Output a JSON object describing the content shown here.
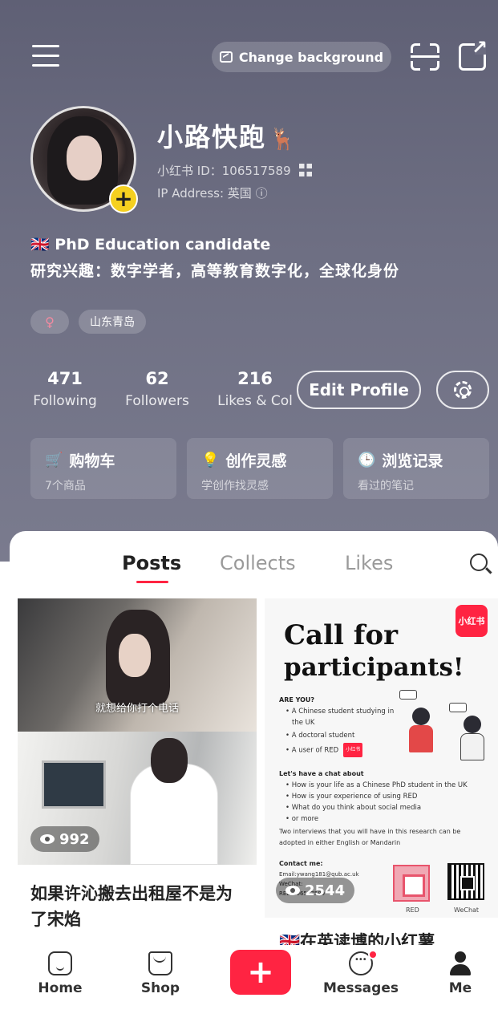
{
  "header": {
    "change_background": "Change background",
    "nickname": "小路快跑",
    "nickname_emoji": "🦌",
    "red_id": "小红书 ID：106517589",
    "ip_address": "IP Address: 英国 ⓘ",
    "bio_line1": "🇬🇧 PhD Education candidate",
    "bio_line2": "研究兴趣：数字学者，高等教育数字化，全球化身份",
    "gender_symbol": "♀",
    "location_tag": "山东青岛",
    "stats": {
      "following_num": "471",
      "following_label": "Following",
      "followers_num": "62",
      "followers_label": "Followers",
      "likes_num": "216",
      "likes_label": "Likes & Col"
    },
    "edit_profile": "Edit Profile",
    "cards": [
      {
        "icon": "🛒",
        "title": "购物车",
        "subtitle": "7个商品"
      },
      {
        "icon": "💡",
        "title": "创作灵感",
        "subtitle": "学创作找灵感"
      },
      {
        "icon": "🕒",
        "title": "浏览记录",
        "subtitle": "看过的笔记"
      }
    ]
  },
  "tabs": [
    "Posts",
    "Collects",
    "Likes"
  ],
  "posts": [
    {
      "image_caption": "就想给你打个电话",
      "views": "992",
      "title": "如果许沁搬去出租屋不是为了宋焰"
    },
    {
      "logo": "小红书",
      "poster_title1": "Call for",
      "poster_title2": "participants!",
      "are_you": "ARE YOU?",
      "bullets1": [
        "• A Chinese student studying in",
        "the UK",
        "• A doctoral student",
        "• A user of RED"
      ],
      "chat_heading": "Let's have a chat about",
      "bullets2": [
        "• How is your life as a Chinese PhD student in the UK",
        "• How is your experience of using RED",
        "• What do you think about social media",
        "• or more"
      ],
      "interviews_line1": "Two interviews that you will have in this research can be",
      "interviews_line2": "adopted in either English or Mandarin",
      "contact_heading": "Contact me:",
      "email": "Email:ywang181@qub.ac.uk",
      "wechat": "WeChat:",
      "red": "RED:106517589",
      "qr_label_red": "RED",
      "qr_label_wechat": "WeChat",
      "views": "2544",
      "title": "🇬🇧在英读博的小红薯"
    }
  ],
  "bottom_nav": {
    "home": "Home",
    "shop": "Shop",
    "add": "+",
    "messages": "Messages",
    "me": "Me"
  },
  "colors": {
    "accent": "#ff2442",
    "header_bg": "#6a6b7f",
    "avatar_plus": "#f5d020"
  }
}
